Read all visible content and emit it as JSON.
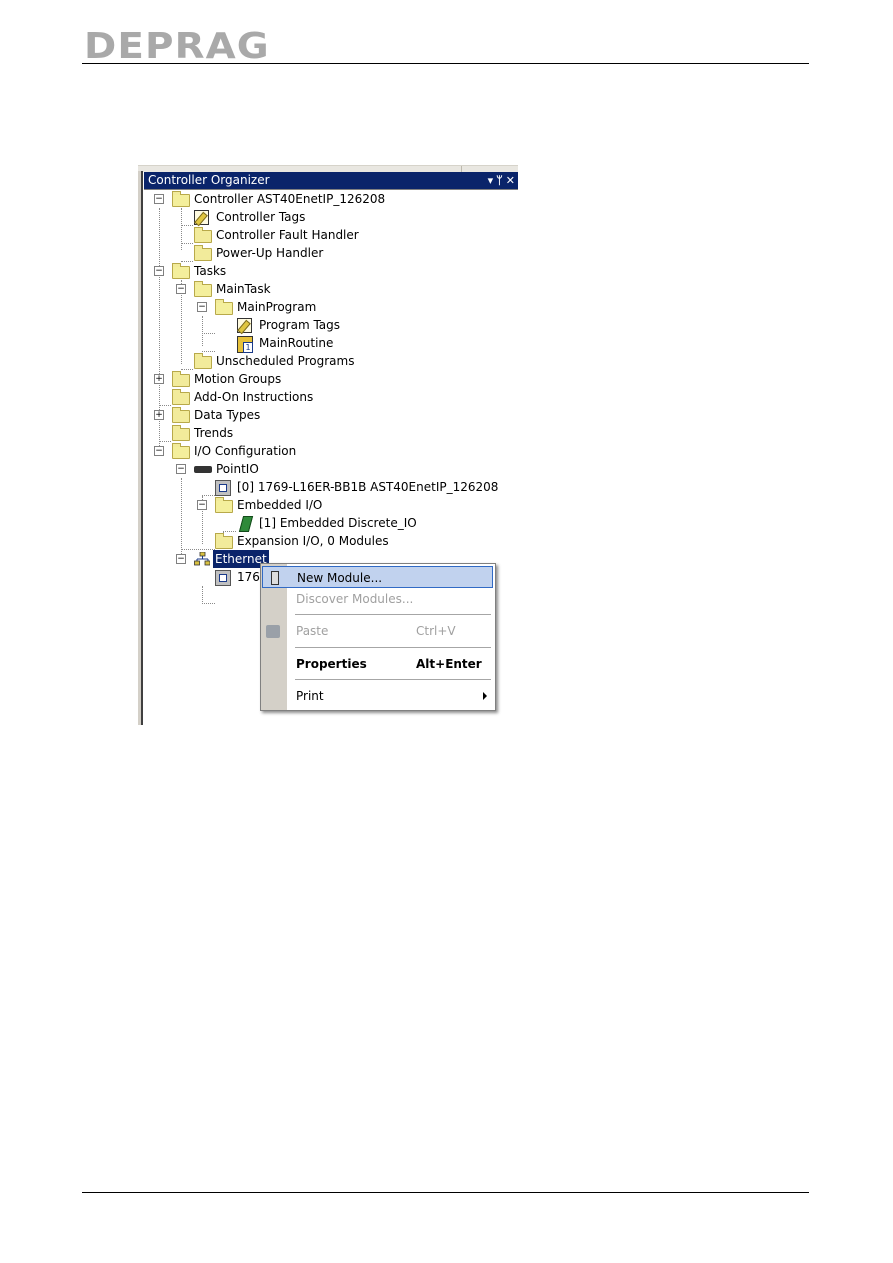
{
  "header": {
    "logo": "DEPRAG"
  },
  "panel": {
    "title": "Controller Organizer",
    "title_buttons": "▾ ⊥ ✕"
  },
  "tree": {
    "nodes": [
      {
        "label": "Controller AST40EnetIP_126208",
        "icon": "folder-open-icon",
        "expander": "−"
      },
      {
        "label": "Controller Tags",
        "icon": "tags-icon"
      },
      {
        "label": "Controller Fault Handler",
        "icon": "folder-icon"
      },
      {
        "label": "Power-Up Handler",
        "icon": "folder-icon"
      },
      {
        "label": "Tasks",
        "icon": "folder-open-icon",
        "expander": "−"
      },
      {
        "label": "MainTask",
        "icon": "task-icon",
        "expander": "−"
      },
      {
        "label": "MainProgram",
        "icon": "program-icon",
        "expander": "−"
      },
      {
        "label": "Program Tags",
        "icon": "tags-icon"
      },
      {
        "label": "MainRoutine",
        "icon": "routine-icon"
      },
      {
        "label": "Unscheduled Programs",
        "icon": "folder-icon"
      },
      {
        "label": "Motion Groups",
        "icon": "folder-icon",
        "expander": "+"
      },
      {
        "label": "Add-On Instructions",
        "icon": "folder-icon"
      },
      {
        "label": "Data Types",
        "icon": "folder-icon",
        "expander": "+"
      },
      {
        "label": "Trends",
        "icon": "folder-icon"
      },
      {
        "label": "I/O Configuration",
        "icon": "folder-open-icon",
        "expander": "−"
      },
      {
        "label": "PointIO",
        "icon": "rack-icon",
        "expander": "−"
      },
      {
        "label": "[0] 1769-L16ER-BB1B AST40EnetIP_126208",
        "icon": "module-icon"
      },
      {
        "label": "Embedded I/O",
        "icon": "folder-open-icon",
        "expander": "−"
      },
      {
        "label": "[1] Embedded Discrete_IO",
        "icon": "discrete-io-icon"
      },
      {
        "label": "Expansion I/O, 0 Modules",
        "icon": "folder-icon"
      },
      {
        "label": "Ethernet",
        "icon": "network-icon",
        "expander": "−",
        "selected": true
      },
      {
        "label": "176",
        "icon": "module-icon"
      }
    ]
  },
  "context_menu": {
    "items": [
      {
        "label": "New Module...",
        "shortcut": "",
        "state": "hover"
      },
      {
        "label": "Discover Modules...",
        "shortcut": "",
        "state": "disabled"
      },
      {
        "label": "Paste",
        "shortcut": "Ctrl+V",
        "state": "disabled"
      },
      {
        "label": "Properties",
        "shortcut": "Alt+Enter",
        "state": "bold"
      },
      {
        "label": "Print",
        "shortcut": "",
        "state": "submenu"
      }
    ]
  }
}
